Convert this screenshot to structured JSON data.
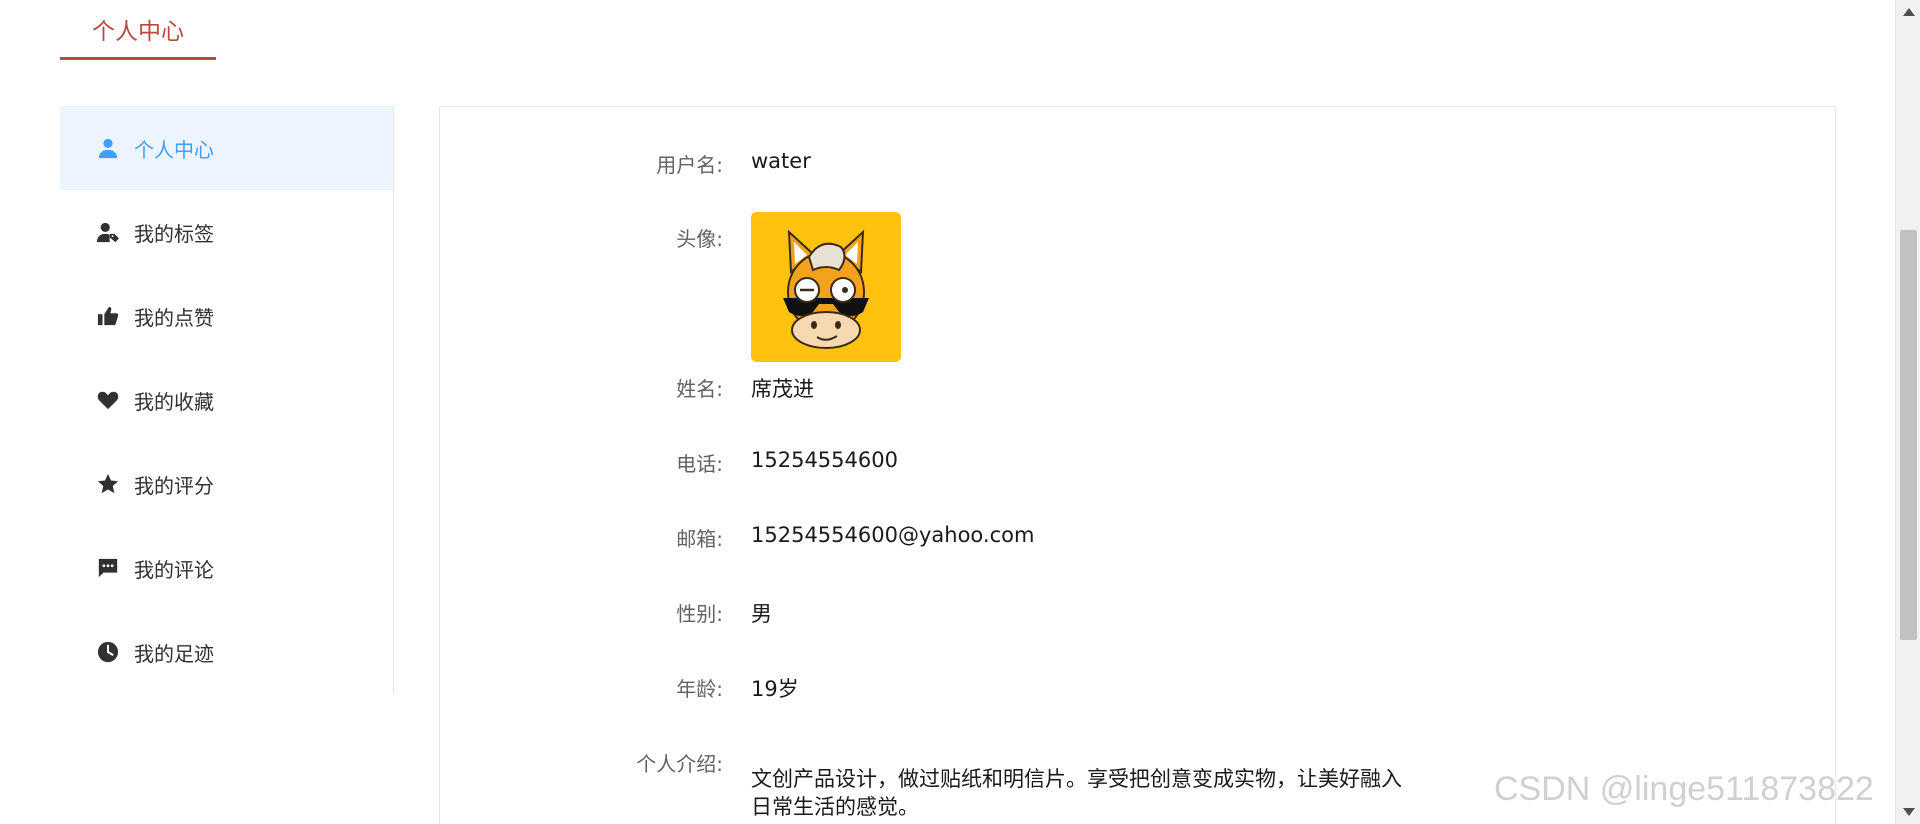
{
  "header": {
    "tab_label": "个人中心"
  },
  "sidebar": {
    "items": [
      {
        "label": "个人中心",
        "icon": "user-icon",
        "active": true
      },
      {
        "label": "我的标签",
        "icon": "user-tag-icon",
        "active": false
      },
      {
        "label": "我的点赞",
        "icon": "thumbs-up-icon",
        "active": false
      },
      {
        "label": "我的收藏",
        "icon": "heart-icon",
        "active": false
      },
      {
        "label": "我的评分",
        "icon": "star-icon",
        "active": false
      },
      {
        "label": "我的评论",
        "icon": "comment-icon",
        "active": false
      },
      {
        "label": "我的足迹",
        "icon": "clock-icon",
        "active": false
      }
    ]
  },
  "profile": {
    "username_label": "用户名:",
    "username": "water",
    "avatar_label": "头像:",
    "name_label": "姓名:",
    "name": "席茂进",
    "phone_label": "电话:",
    "phone": "15254554600",
    "email_label": "邮箱:",
    "email": "15254554600@yahoo.com",
    "gender_label": "性别:",
    "gender": "男",
    "age_label": "年龄:",
    "age": "19岁",
    "intro_label": "个人介绍:",
    "intro": "文创产品设计，做过贴纸和明信片。享受把创意变成实物，让美好融入日常生活的感觉。"
  },
  "watermark": "CSDN @linge511873822",
  "colors": {
    "accent_red": "#b84a43",
    "active_blue": "#409eff",
    "active_bg": "#ecf5ff",
    "avatar_bg": "#ffc20e"
  }
}
